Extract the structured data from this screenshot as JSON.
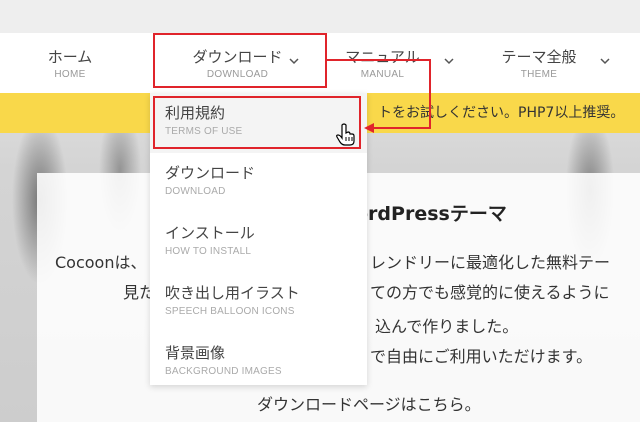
{
  "nav": {
    "items": [
      {
        "label": "ホーム",
        "sub": "HOME"
      },
      {
        "label": "ダウンロード",
        "sub": "DOWNLOAD"
      },
      {
        "label": "マニュアル",
        "sub": "MANUAL"
      },
      {
        "label": "テーマ全般",
        "sub": "THEME"
      }
    ]
  },
  "notice": {
    "text": "トをお試しください。PHP7以上推奨。"
  },
  "dropdown": {
    "items": [
      {
        "label": "利用規約",
        "sub": "TERMS OF USE"
      },
      {
        "label": "ダウンロード",
        "sub": "DOWNLOAD"
      },
      {
        "label": "インストール",
        "sub": "HOW TO INSTALL"
      },
      {
        "label": "吹き出し用イラスト",
        "sub": "SPEECH BALLOON ICONS"
      },
      {
        "label": "背景画像",
        "sub": "BACKGROUND IMAGES"
      }
    ]
  },
  "card": {
    "title": "ordPressテーマ",
    "lines": [
      "Cocoonは、",
      "レンドリーに最適化した無料テー",
      "見た",
      "ての方でも感覚的に使えるように",
      "込んで作りました。",
      "で自由にご利用いただけます。",
      "ダウンロードページはこちら。"
    ]
  },
  "colors": {
    "accent_red": "#e0242b",
    "notice_yellow": "#f9d84a"
  }
}
